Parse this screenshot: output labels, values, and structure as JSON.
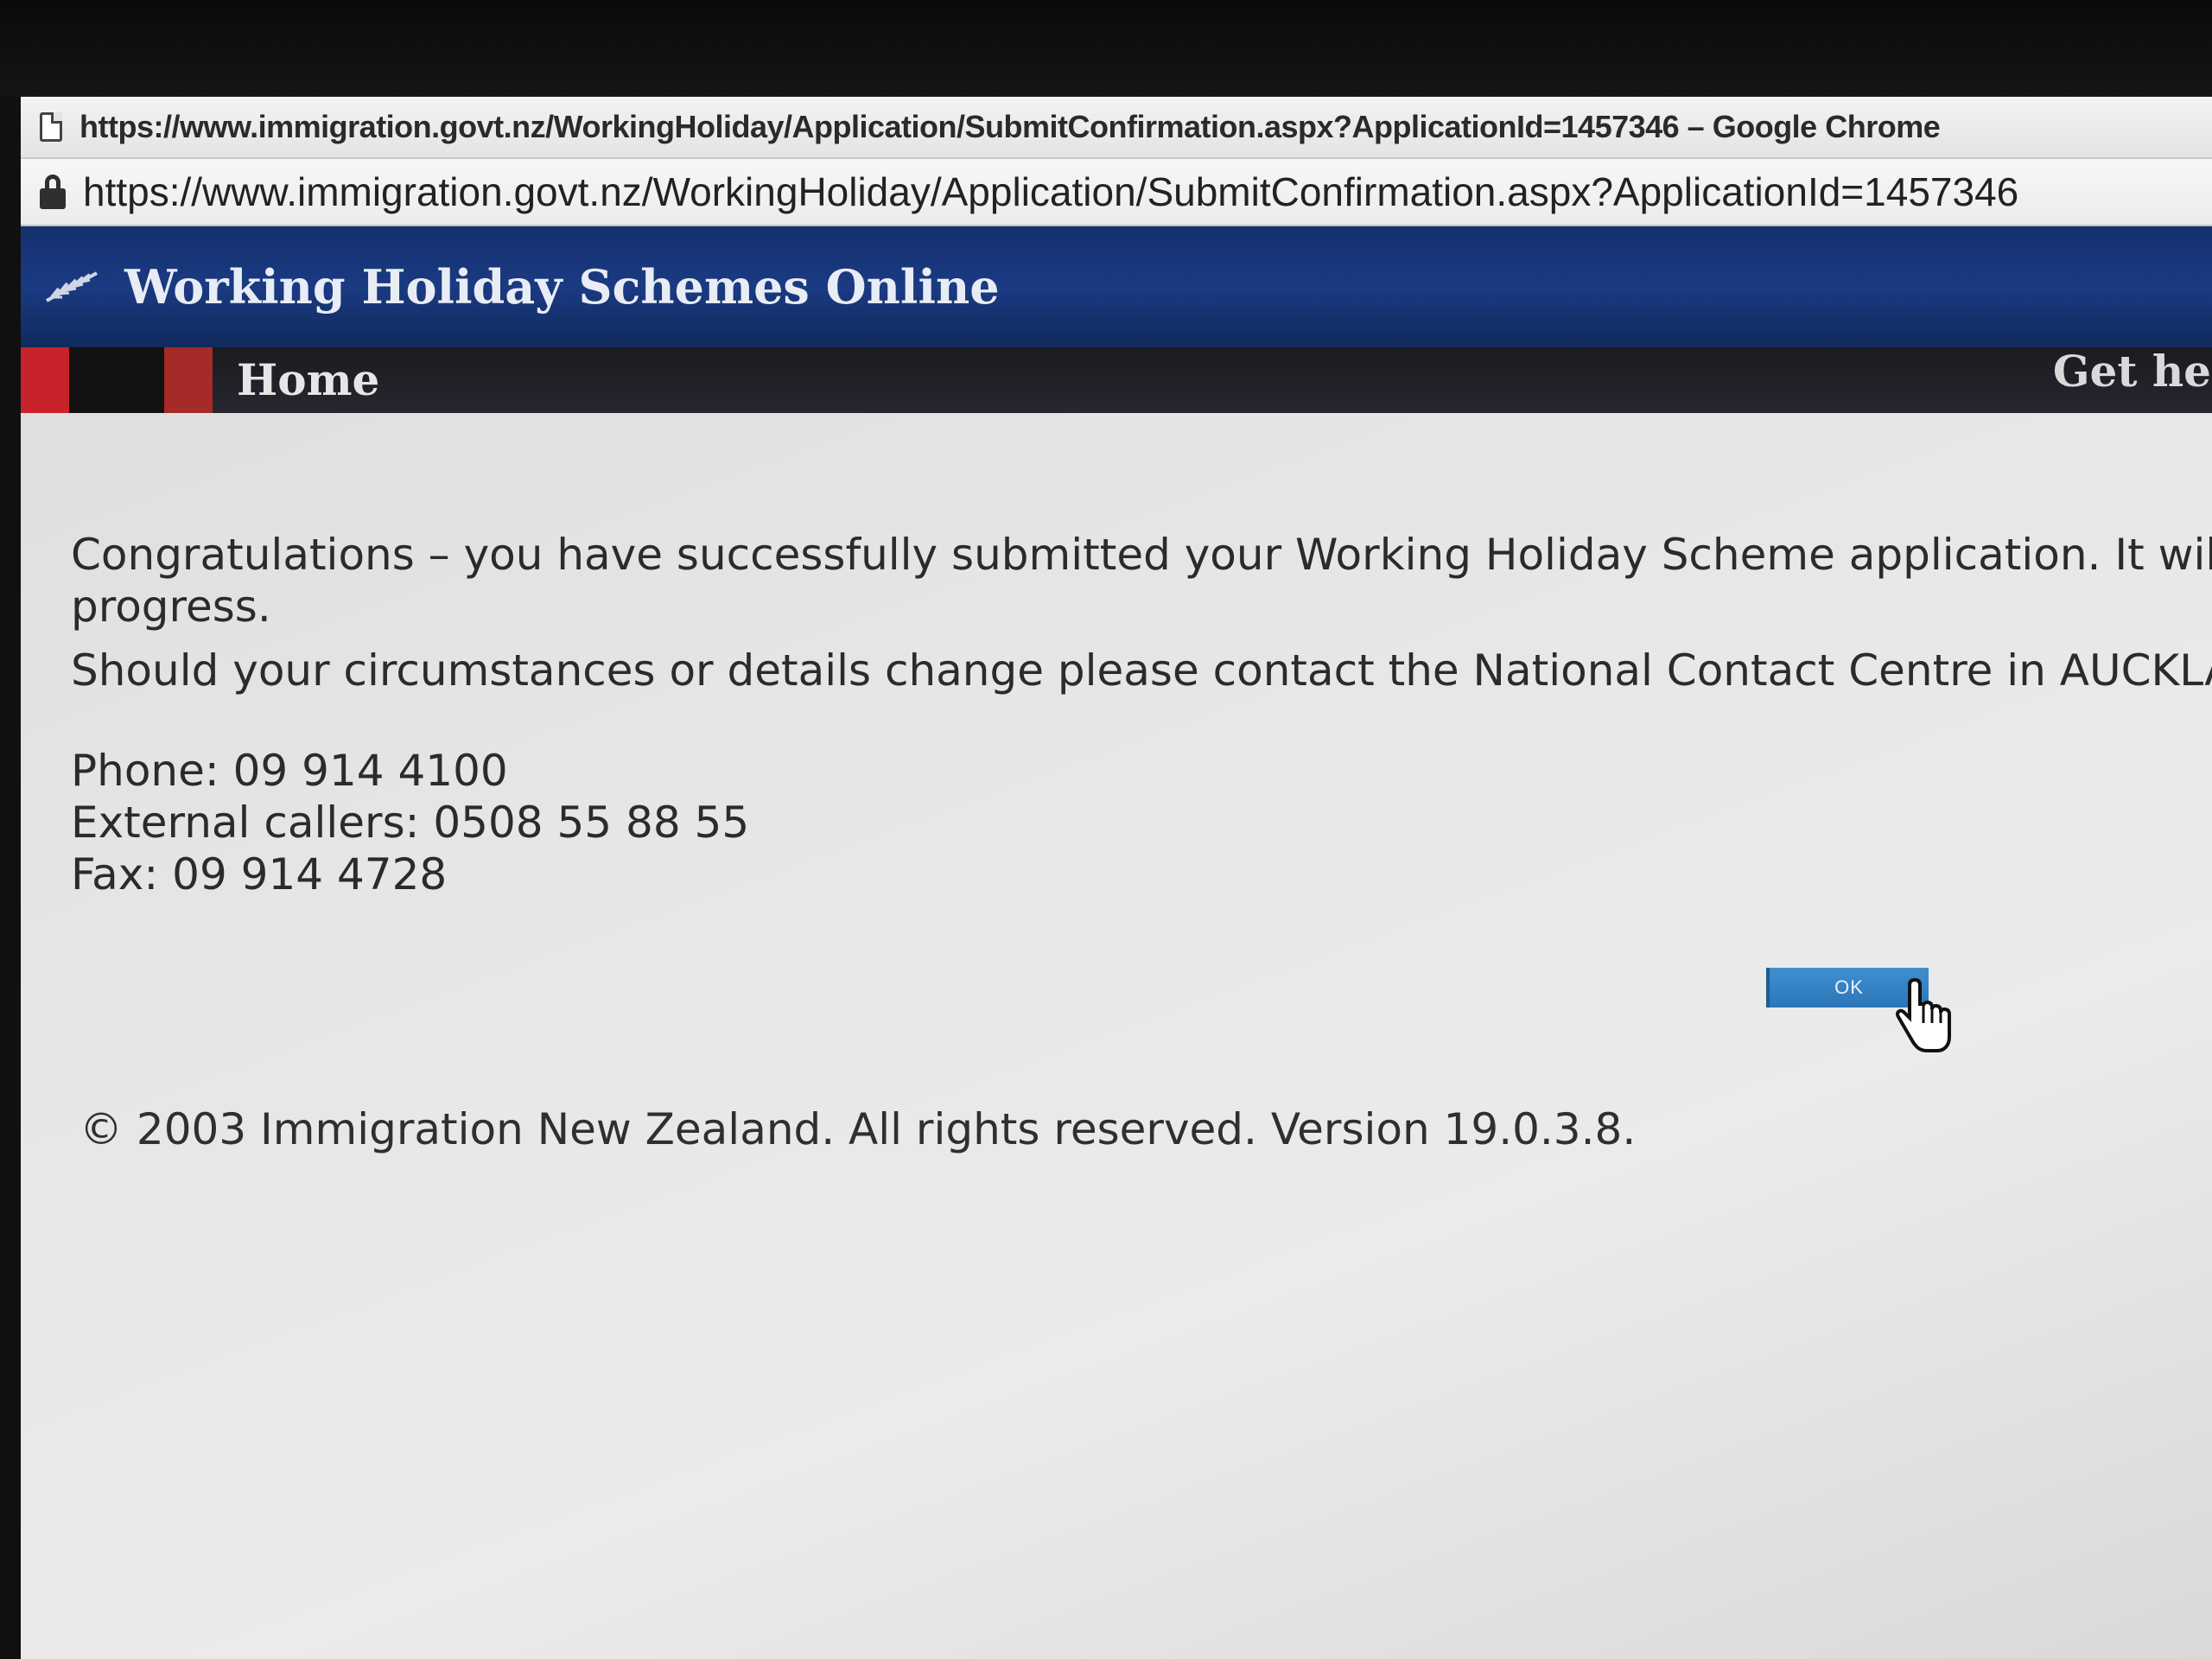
{
  "browser": {
    "window_title": "https://www.immigration.govt.nz/WorkingHoliday/Application/SubmitConfirmation.aspx?ApplicationId=1457346 – Google Chrome",
    "url": "https://www.immigration.govt.nz/WorkingHoliday/Application/SubmitConfirmation.aspx?ApplicationId=1457346"
  },
  "header": {
    "site_title": "Working Holiday Schemes Online"
  },
  "nav": {
    "home_label": "Home",
    "help_label": "Get hel"
  },
  "message": {
    "congrats": "Congratulations – you have successfully submitted your Working Holiday Scheme application. It will b",
    "progress": "progress.",
    "should": "Should your circumstances or details change please contact the National Contact Centre in AUCKLAN"
  },
  "contact": {
    "phone": "Phone: 09 914 4100",
    "external": "External callers: 0508 55 88 55",
    "fax": "Fax: 09 914 4728"
  },
  "actions": {
    "ok_label": "OK"
  },
  "footer": {
    "copyright_symbol": "©",
    "text": "2003 Immigration New Zealand. All rights reserved. Version 19.0.3.8."
  },
  "colors": {
    "header_blue": "#1a3a82",
    "nav_red": "#c8232a",
    "ok_blue": "#2b76b8"
  },
  "icons": [
    "page-icon",
    "lock-icon",
    "fern-icon",
    "hand-cursor-icon"
  ]
}
